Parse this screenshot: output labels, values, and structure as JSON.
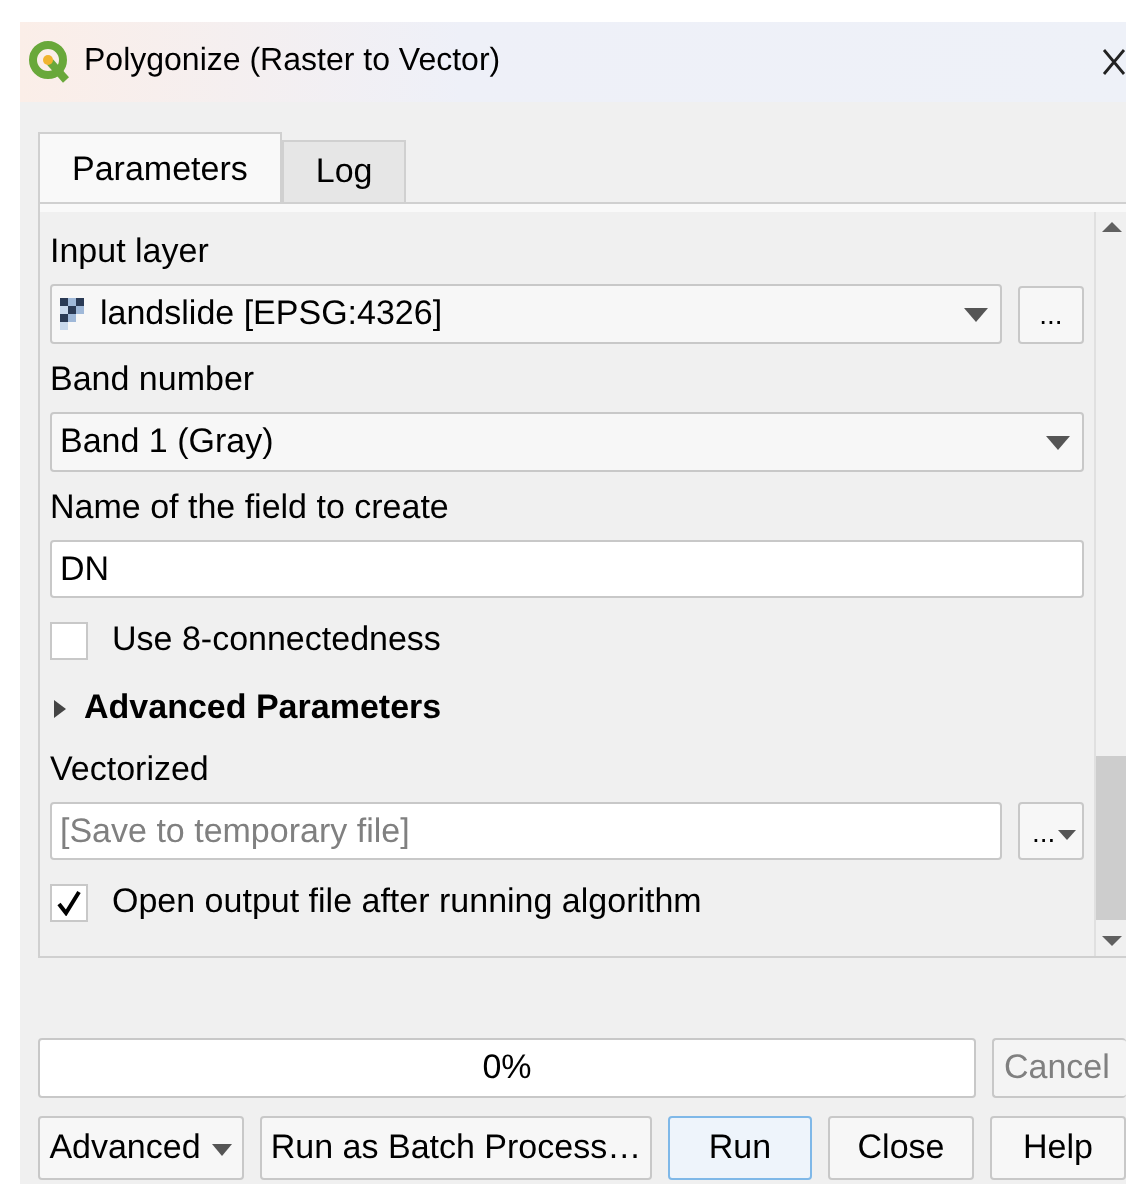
{
  "window": {
    "title": "Polygonize (Raster to Vector)"
  },
  "tabs": [
    {
      "label": "Parameters",
      "selected": true
    },
    {
      "label": "Log",
      "selected": false
    }
  ],
  "parameters": [
    {
      "kind": "layer_combo",
      "label": "Input layer",
      "value": "landslide [EPSG:4326]",
      "browse": "..."
    },
    {
      "kind": "combo",
      "label": "Band number",
      "value": "Band 1 (Gray)"
    },
    {
      "kind": "text",
      "label": "Name of the field to create",
      "value": "DN"
    },
    {
      "kind": "checkbox",
      "label": "Use 8-connectedness",
      "checked": false
    },
    {
      "kind": "section",
      "label": "Advanced Parameters",
      "expanded": false
    },
    {
      "kind": "output",
      "label": "Vectorized",
      "placeholder": "[Save to temporary file]",
      "browse": "..."
    },
    {
      "kind": "checkbox",
      "label": "Open output file after running algorithm",
      "checked": true
    }
  ],
  "progress": {
    "level": 0,
    "reading": "0%"
  },
  "cancel": {
    "label": "Cancel",
    "disabled": true
  },
  "buttons": [
    {
      "label": "Advanced",
      "kind": "menu"
    },
    {
      "label": "Run as Batch Process…",
      "kind": "plain"
    },
    {
      "label": "Run",
      "kind": "default"
    },
    {
      "label": "Close",
      "kind": "plain"
    },
    {
      "label": "Help",
      "kind": "plain"
    }
  ]
}
